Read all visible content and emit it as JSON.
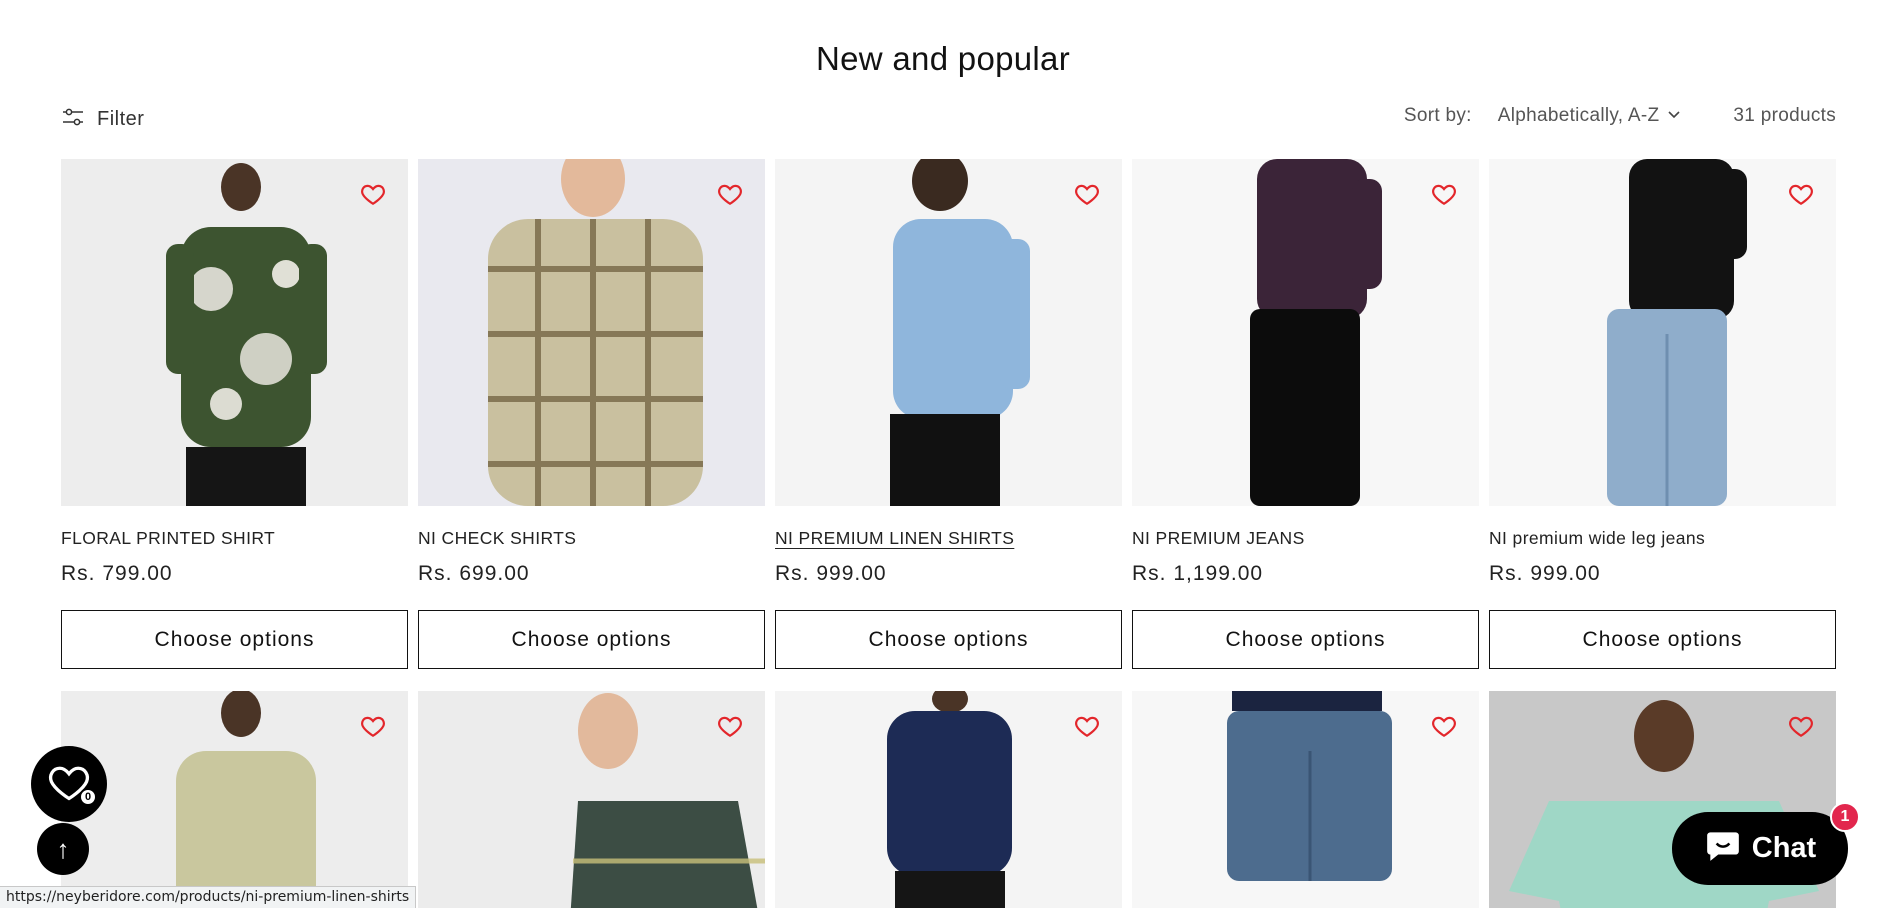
{
  "page": {
    "title": "New and popular"
  },
  "toolbar": {
    "filter_label": "Filter",
    "sort_label": "Sort by:",
    "sort_value": "Alphabetically, A-Z",
    "product_count": "31 products"
  },
  "products": [
    {
      "title": "FLORAL PRINTED SHIRT",
      "price": "Rs. 799.00",
      "button": "Choose options"
    },
    {
      "title": "NI CHECK SHIRTS",
      "price": "Rs. 699.00",
      "button": "Choose options"
    },
    {
      "title": "NI PREMIUM LINEN SHIRTS",
      "price": "Rs. 999.00",
      "button": "Choose options"
    },
    {
      "title": "NI PREMIUM JEANS",
      "price": "Rs. 1,199.00",
      "button": "Choose options"
    },
    {
      "title": "NI premium wide leg jeans",
      "price": "Rs. 999.00",
      "button": "Choose options"
    }
  ],
  "floating": {
    "wishlist_count": "0",
    "back_to_top": "↑",
    "chat_label": "Chat",
    "chat_badge": "1"
  },
  "status_bar": {
    "url": "https://neyberidore.com/products/ni-premium-linen-shirts"
  },
  "icons": {
    "filter": "filter-icon",
    "sort": "chevron-down-icon",
    "wishlist": "heart-icon",
    "chat": "chat-bubble-icon"
  },
  "colors": {
    "heart": "#e3262b",
    "chat_badge": "#e2264d",
    "text": "#121212"
  }
}
